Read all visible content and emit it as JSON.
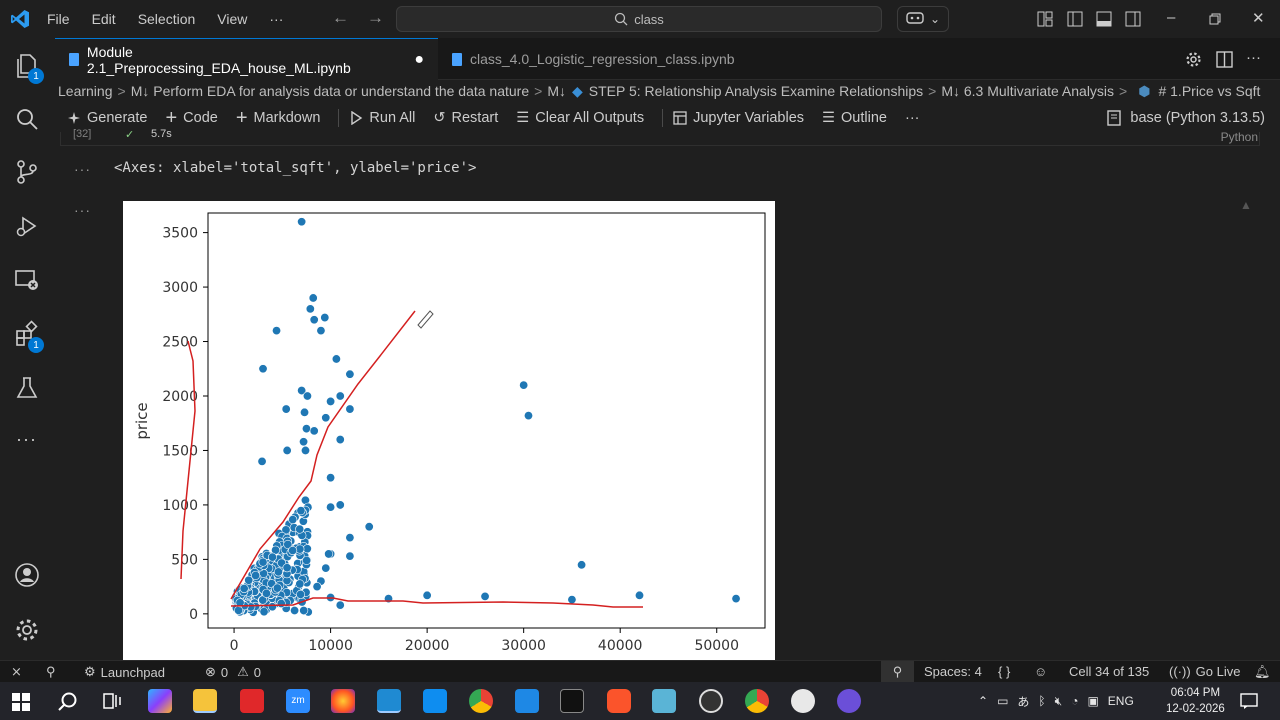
{
  "titlebar": {
    "menu": [
      "File",
      "Edit",
      "Selection",
      "View",
      "···"
    ],
    "search_text": "class"
  },
  "activity_badges": {
    "explorer": "1",
    "extensions": "1"
  },
  "tabs": [
    {
      "label": "Module 2.1_Preprocessing_EDA_house_ML.ipynb",
      "modified": true
    },
    {
      "label": "class_4.0_Logistic_regression_class.ipynb",
      "modified": false
    }
  ],
  "breadcrumb": [
    "Learning",
    "M↓ Perform EDA for analysis data or understand the data nature",
    "M↓",
    "STEP 5: Relationship Analysis Examine Relationships",
    "M↓ 6.3 Multivariate Analysis",
    "# 1.Price vs Sqft"
  ],
  "toolbar": {
    "generate": "Generate",
    "code": "Code",
    "markdown": "Markdown",
    "run_all": "Run All",
    "restart": "Restart",
    "clear_outputs": "Clear All Outputs",
    "jupyter_vars": "Jupyter Variables",
    "outline": "Outline",
    "more": "···",
    "kernel": "base (Python 3.13.5)"
  },
  "cell": {
    "exec_count": "[32]",
    "exec_time": "5.7s",
    "language": "Python",
    "output_text": "<Axes: xlabel='total_sqft', ylabel='price'>",
    "ellipsis": "···"
  },
  "chart_data": {
    "type": "scatter",
    "xlabel": "",
    "ylabel": "price",
    "xlim": [
      -2700,
      55000
    ],
    "ylim": [
      -130,
      3680
    ],
    "x_ticks": [
      0,
      10000,
      20000,
      30000,
      40000,
      50000
    ],
    "y_ticks": [
      0,
      500,
      1000,
      1500,
      2000,
      2500,
      3000,
      3500
    ],
    "points_color": "#1f77b4",
    "outliers": [
      {
        "x": 7000,
        "y": 3600
      },
      {
        "x": 8200,
        "y": 2900
      },
      {
        "x": 7900,
        "y": 2800
      },
      {
        "x": 9400,
        "y": 2720
      },
      {
        "x": 8300,
        "y": 2700
      },
      {
        "x": 9000,
        "y": 2600
      },
      {
        "x": 4400,
        "y": 2600
      },
      {
        "x": 10600,
        "y": 2340
      },
      {
        "x": 3000,
        "y": 2250
      },
      {
        "x": 12000,
        "y": 2200
      },
      {
        "x": 7000,
        "y": 2050
      },
      {
        "x": 7600,
        "y": 2000
      },
      {
        "x": 11000,
        "y": 2000
      },
      {
        "x": 30000,
        "y": 2100
      },
      {
        "x": 30500,
        "y": 1820
      },
      {
        "x": 10000,
        "y": 1950
      },
      {
        "x": 12000,
        "y": 1880
      },
      {
        "x": 5400,
        "y": 1880
      },
      {
        "x": 7300,
        "y": 1850
      },
      {
        "x": 9500,
        "y": 1800
      },
      {
        "x": 7500,
        "y": 1700
      },
      {
        "x": 8300,
        "y": 1680
      },
      {
        "x": 11000,
        "y": 1600
      },
      {
        "x": 7200,
        "y": 1580
      },
      {
        "x": 7400,
        "y": 1500
      },
      {
        "x": 5500,
        "y": 1500
      },
      {
        "x": 2900,
        "y": 1400
      },
      {
        "x": 10000,
        "y": 1250
      },
      {
        "x": 11000,
        "y": 1000
      },
      {
        "x": 10000,
        "y": 980
      },
      {
        "x": 14000,
        "y": 800
      },
      {
        "x": 12000,
        "y": 700
      },
      {
        "x": 12000,
        "y": 530
      },
      {
        "x": 10000,
        "y": 550
      },
      {
        "x": 9800,
        "y": 550
      },
      {
        "x": 9500,
        "y": 420
      },
      {
        "x": 36000,
        "y": 450
      },
      {
        "x": 9000,
        "y": 300
      },
      {
        "x": 8600,
        "y": 250
      },
      {
        "x": 16000,
        "y": 140
      },
      {
        "x": 20000,
        "y": 170
      },
      {
        "x": 26000,
        "y": 160
      },
      {
        "x": 35000,
        "y": 130
      },
      {
        "x": 42000,
        "y": 170
      },
      {
        "x": 52000,
        "y": 140
      },
      {
        "x": 11000,
        "y": 80
      },
      {
        "x": 10000,
        "y": 150
      }
    ]
  },
  "statusbar": {
    "launchpad": "Launchpad",
    "errors": "0",
    "warnings": "0",
    "spaces": "Spaces: 4",
    "braces": "{ }",
    "cell_pos": "Cell 34 of 135",
    "go_live": "Go Live"
  },
  "taskbar": {
    "lang": "ENG",
    "time": "06:04 PM",
    "date": "12-02-2026"
  }
}
